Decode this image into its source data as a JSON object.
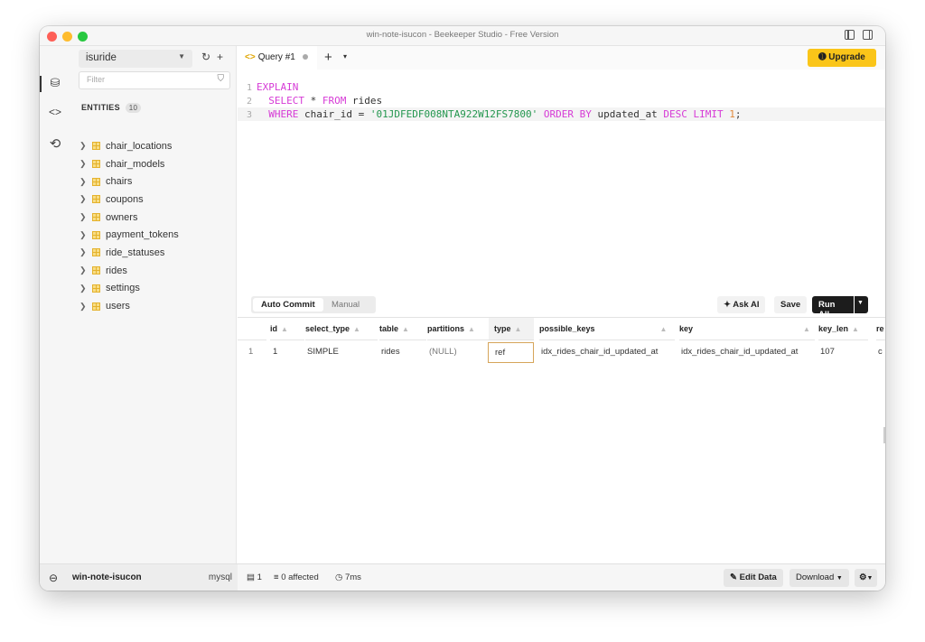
{
  "window": {
    "title": "win-note-isucon - Beekeeper Studio - Free Version"
  },
  "rail": {
    "items": [
      {
        "icon": "database-icon",
        "glyph": "⛁"
      },
      {
        "icon": "code-icon",
        "glyph": "<>"
      },
      {
        "icon": "history-icon",
        "glyph": "⟲"
      }
    ]
  },
  "sidebar": {
    "database": "isuride",
    "filter_placeholder": "Filter",
    "entities_label": "ENTITIES",
    "entities_count": "10",
    "tables": [
      "chair_locations",
      "chair_models",
      "chairs",
      "coupons",
      "owners",
      "payment_tokens",
      "ride_statuses",
      "rides",
      "settings",
      "users"
    ]
  },
  "connection": {
    "name": "win-note-isucon",
    "type": "mysql"
  },
  "tabs": {
    "active_label": "Query #1",
    "code_glyph": "<>",
    "add_glyph": "+",
    "menu_glyph": "▾"
  },
  "upgrade_label": "Upgrade",
  "editor": {
    "line_numbers": [
      "1",
      "2",
      "3"
    ],
    "line1": {
      "kw": "EXPLAIN"
    },
    "line2": {
      "kw1": "SELECT",
      "star": " * ",
      "kw2": "FROM",
      "ident": " rides"
    },
    "line3": {
      "kw1": "WHERE",
      "ident1": " chair_id = ",
      "str": "'01JDFEDF008NTA922W12FS7800'",
      "kw2": " ORDER BY",
      "ident2": " updated_at ",
      "kw3": "DESC LIMIT",
      "num": " 1",
      "end": ";"
    }
  },
  "toolbar": {
    "auto_commit": "Auto Commit",
    "manual": "Manual",
    "ask_ai": "Ask AI",
    "save": "Save",
    "run_all": "Run All"
  },
  "results": {
    "columns": [
      "id",
      "select_type",
      "table",
      "partitions",
      "type",
      "possible_keys",
      "key",
      "key_len",
      "re"
    ],
    "row_number": "1",
    "row": [
      "1",
      "SIMPLE",
      "rides",
      "(NULL)",
      "ref",
      "idx_rides_chair_id_updated_at",
      "idx_rides_chair_id_updated_at",
      "107",
      "c"
    ]
  },
  "status": {
    "rows": "1",
    "affected": "0 affected",
    "time": "7ms",
    "edit_data": "Edit Data",
    "download": "Download"
  }
}
